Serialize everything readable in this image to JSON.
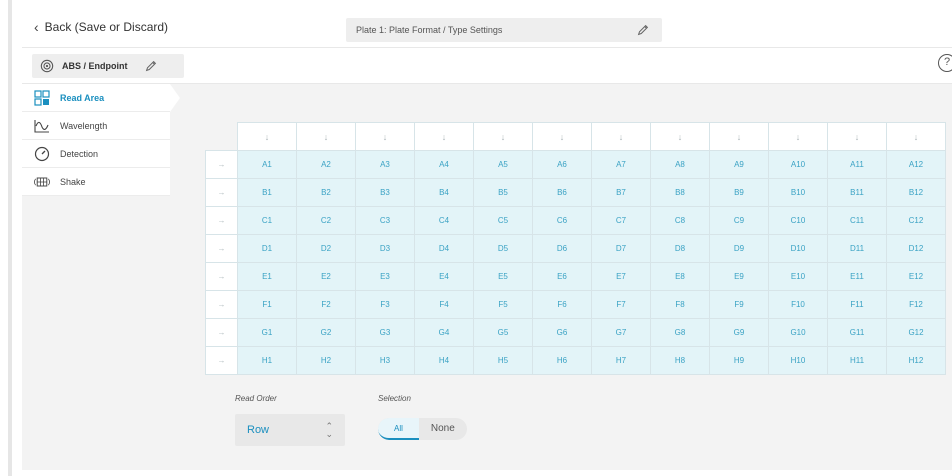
{
  "topbar": {
    "back_label": "Back (Save or Discard)",
    "plate_title": "Plate 1: Plate Format / Type Settings"
  },
  "mode": {
    "label": "ABS / Endpoint"
  },
  "help": {
    "label": "?"
  },
  "sidebar": {
    "items": [
      {
        "label": "Read Area",
        "icon": "read-area-icon",
        "active": true
      },
      {
        "label": "Wavelength",
        "icon": "wavelength-icon",
        "active": false
      },
      {
        "label": "Detection",
        "icon": "detection-icon",
        "active": false
      },
      {
        "label": "Shake",
        "icon": "shake-icon",
        "active": false
      }
    ]
  },
  "plate": {
    "rows": [
      "A",
      "B",
      "C",
      "D",
      "E",
      "F",
      "G",
      "H"
    ],
    "columns": [
      "1",
      "2",
      "3",
      "4",
      "5",
      "6",
      "7",
      "8",
      "9",
      "10",
      "11",
      "12"
    ],
    "col_arrow": "↓",
    "row_arrow": "→"
  },
  "read_order": {
    "label": "Read Order",
    "value": "Row"
  },
  "selection": {
    "label": "Selection",
    "all_label": "All",
    "none_label": "None",
    "selected": "All"
  },
  "colors": {
    "accent": "#1a8fbf",
    "well_fill": "#e3f4f8",
    "well_text": "#3aa2c4"
  }
}
